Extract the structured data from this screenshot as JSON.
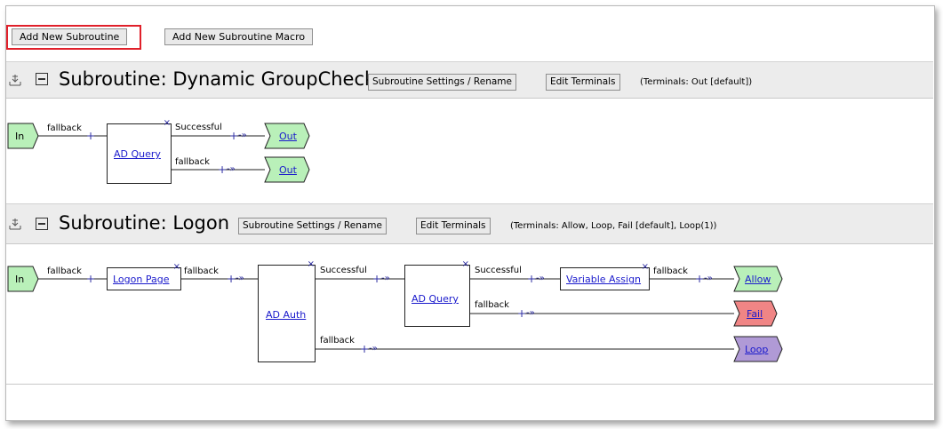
{
  "toolbar": {
    "add_subroutine": "Add New Subroutine",
    "add_macro": "Add New Subroutine Macro"
  },
  "sub1": {
    "title": "Subroutine: Dynamic GroupCheck",
    "settings": "Subroutine Settings / Rename",
    "edit_terminals": "Edit Terminals",
    "terminals": "(Terminals: Out [default])",
    "in": "In",
    "fallback_in": "fallback",
    "node": "AD Query",
    "successful": "Successful",
    "fallback": "fallback",
    "out1": "Out",
    "out2": "Out"
  },
  "sub2": {
    "title": "Subroutine: Logon",
    "settings": "Subroutine Settings / Rename",
    "edit_terminals": "Edit Terminals",
    "terminals": "(Terminals: Allow, Loop, Fail [default], Loop(1))",
    "in": "In",
    "fallback_in": "fallback",
    "logon_page": "Logon Page",
    "fallback_lp": "fallback",
    "ad_auth": "AD Auth",
    "successful_auth": "Successful",
    "fallback_auth": "fallback",
    "ad_query": "AD Query",
    "successful_query": "Successful",
    "fallback_query": "fallback",
    "variable_assign": "Variable Assign",
    "fallback_va": "fallback",
    "allow": "Allow",
    "fail": "Fail",
    "loop": "Loop"
  },
  "colors": {
    "green": "#b9f0b9",
    "red": "#f08585",
    "purple": "#b09ad6",
    "highlight": "#e0202a"
  }
}
